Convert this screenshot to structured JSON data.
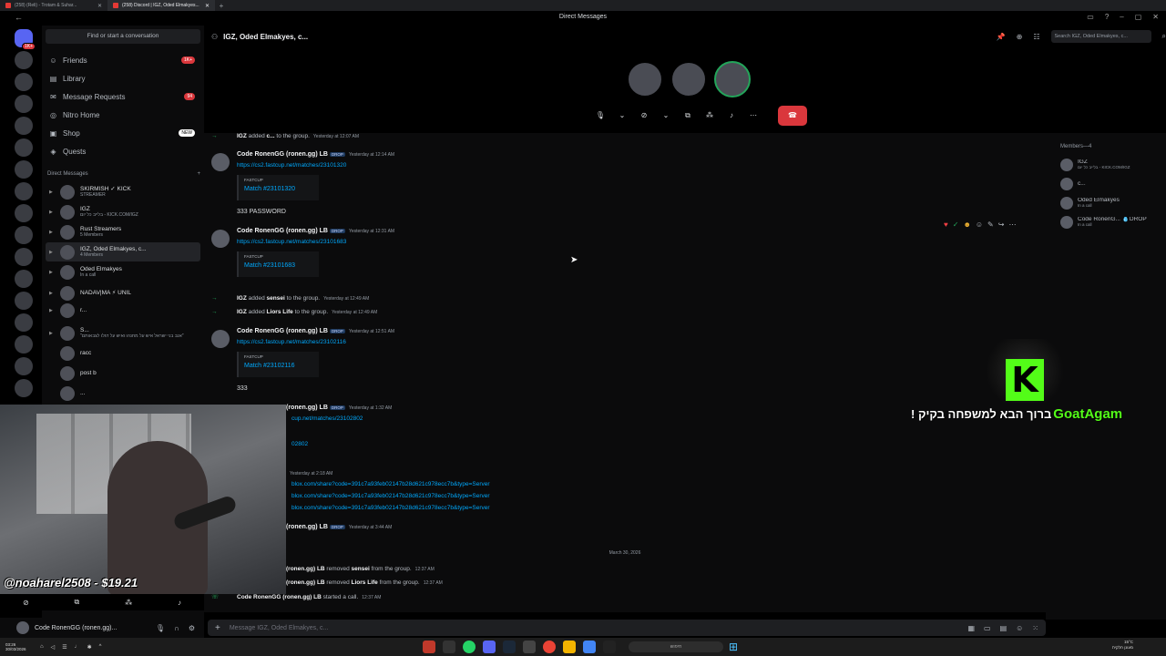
{
  "browser": {
    "tabs": [
      {
        "label": "(258) (Reli) - Trotam & Suhar..."
      },
      {
        "label": "(258) Discord | IGZ, Oded Elmakyes..."
      }
    ],
    "window_title": "Direct Messages"
  },
  "sidebar": {
    "search_placeholder": "Find or start a conversation",
    "nav": [
      {
        "label": "Friends",
        "icon": "friends-icon",
        "badge": "1K+"
      },
      {
        "label": "Library",
        "icon": "library-icon",
        "badge": ""
      },
      {
        "label": "Message Requests",
        "icon": "mail-icon",
        "badge": "94"
      },
      {
        "label": "Nitro Home",
        "icon": "nitro-icon",
        "badge": ""
      },
      {
        "label": "Shop",
        "icon": "shop-icon",
        "badge": "NEW"
      },
      {
        "label": "Quests",
        "icon": "quests-icon",
        "badge": ""
      }
    ],
    "dm_header": "Direct Messages",
    "dms": [
      {
        "name": "SKIRMISH ✓ KICK",
        "sub": "STREAMER"
      },
      {
        "name": "IGZ",
        "sub": "בלייב כל יום - KICK.COM/IGZ"
      },
      {
        "name": "Rust Streamers",
        "sub": "5 Members"
      },
      {
        "name": "IGZ, Oded Elmakyes, c...",
        "sub": "4 Members"
      },
      {
        "name": "Oded Elmakyes",
        "sub": "In a call"
      },
      {
        "name": "NADAV|MA ⚡ UNIL",
        "sub": ""
      },
      {
        "name": "r...",
        "sub": ""
      },
      {
        "name": "S...",
        "sub": "\"אנב בני ישראל איש על מחנהו ואיש על דגלו לצבאותם\""
      },
      {
        "name": "racc",
        "sub": ""
      },
      {
        "name": "post b",
        "sub": ""
      },
      {
        "name": "...",
        "sub": ""
      }
    ]
  },
  "user_panel": {
    "name": "Code RonenGG (ronen.gg)..."
  },
  "channel": {
    "name": "IGZ, Oded Elmakyes, c...",
    "search_placeholder": "Search IGZ, Oded Elmakyes, c..."
  },
  "messages": {
    "sys_top": {
      "actor": "IGZ",
      "text": "added",
      "target": "c...",
      "rest": "to the group.",
      "ts": "Yesterday at 12:07 AM"
    },
    "m1": {
      "author": "Code RonenGG (ronen.gg) LB",
      "tag": "DROP",
      "ts": "Yesterday at 12:14 AM",
      "link": "https://cs2.fastcup.net/matches/23101320",
      "provider": "FASTCUP",
      "embed_title": "Match #23101320",
      "body": "333 PASSWORD"
    },
    "m2": {
      "author": "Code RonenGG (ronen.gg) LB",
      "tag": "DROP",
      "ts": "Yesterday at 12:31 AM",
      "link": "https://cs2.fastcup.net/matches/23101683",
      "provider": "FASTCUP",
      "embed_title": "Match #23101683"
    },
    "sys1": {
      "actor": "IGZ",
      "verb": "added",
      "target": "sensei",
      "rest": "to the group.",
      "ts": "Yesterday at 12:49 AM"
    },
    "sys2": {
      "actor": "IGZ",
      "verb": "added",
      "target": "Liors Life",
      "rest": "to the group.",
      "ts": "Yesterday at 12:49 AM"
    },
    "m3": {
      "author": "Code RonenGG (ronen.gg) LB",
      "tag": "DROP",
      "ts": "Yesterday at 12:51 AM",
      "link": "https://cs2.fastcup.net/matches/23102116",
      "provider": "FASTCUP",
      "embed_title": "Match #23102116",
      "body": "333"
    },
    "m4": {
      "author": "(ronen.gg) LB",
      "tag": "DROP",
      "ts": "Yesterday at 1:32 AM",
      "link": "cup.net/matches/23102802",
      "embed_frag": "02802"
    },
    "m5": {
      "ts": "Yesterday at 2:18 AM",
      "links": [
        "blox.com/share?code=391c7a93feb02147b28d621c978ecc7b&type=Server",
        "blox.com/share?code=391c7a93feb02147b28d621c978ecc7b&type=Server",
        "blox.com/share?code=391c7a93feb02147b28d621c978ecc7b&type=Server"
      ]
    },
    "m6": {
      "author": "(ronen.gg) LB",
      "tag": "DROP",
      "ts": "Yesterday at 3:44 AM"
    },
    "date_divider": "March 30, 2026",
    "sys3": {
      "actor": "(ronen.gg) LB",
      "verb": "removed",
      "target": "sensei",
      "rest": "from the group.",
      "ts": "12:37 AM"
    },
    "sys4": {
      "actor": "(ronen.gg) LB",
      "verb": "removed",
      "target": "Liors Life",
      "rest": "from the group.",
      "ts": "12:37 AM"
    },
    "sys5": {
      "actor": "Code RonenGG (ronen.gg) LB",
      "verb": "started a call.",
      "ts": "12:37 AM"
    }
  },
  "composer": {
    "placeholder": "Message IGZ, Oded Elmakyes, c..."
  },
  "members": {
    "header": "Members—4",
    "list": [
      {
        "name": "IGZ",
        "sub": "בלייב כל יום - KICK.COM/IGZ"
      },
      {
        "name": "c...",
        "sub": ""
      },
      {
        "name": "Oded Elmakyes",
        "sub": "In a call"
      },
      {
        "name": "Code RonenG... 💧DROP",
        "sub": "In a call"
      }
    ]
  },
  "stream": {
    "donation": "@noaharel2508 - $19.21",
    "follow_text": "! ברוך הבא למשפחה בקיק",
    "follow_user": "GoatAgam",
    "kick_letter": "K"
  },
  "taskbar": {
    "time": "03:26",
    "date": "30/03/2026",
    "search": "חיפוש",
    "weather_temp": "15°C",
    "weather_desc": "מעונן חלקית"
  },
  "colors": {
    "accent": "#5865f2",
    "link": "#00a8fc",
    "danger": "#da373c",
    "online": "#23a55a",
    "kick": "#53fc18"
  }
}
